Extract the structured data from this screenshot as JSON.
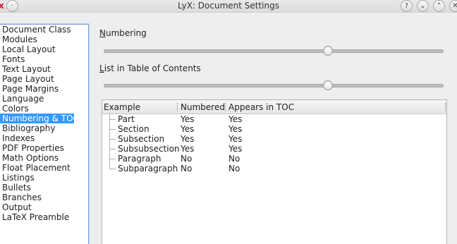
{
  "window": {
    "title": "LyX: Document Settings",
    "close_glyph": "x",
    "buttons": [
      "?",
      "⌄",
      "⌃",
      "✕"
    ]
  },
  "sidebar": {
    "items": [
      "Document Class",
      "Modules",
      "Local Layout",
      "Fonts",
      "Text Layout",
      "Page Layout",
      "Page Margins",
      "Language",
      "Colors",
      "Numbering & TOC",
      "Bibliography",
      "Indexes",
      "PDF Properties",
      "Math Options",
      "Float Placement",
      "Listings",
      "Bullets",
      "Branches",
      "Output",
      "LaTeX Preamble"
    ],
    "selected": "Numbering & TOC"
  },
  "numbering": {
    "label_first": "N",
    "label_rest": "umbering",
    "slider_level": 0.66
  },
  "toc": {
    "label_first": "L",
    "label_rest": "ist in Table of Contents",
    "slider_level": 0.66
  },
  "table": {
    "headers": {
      "example": "Example",
      "numbered": "Numbered",
      "toc": "Appears in TOC"
    },
    "rows": [
      {
        "example": "Part",
        "numbered": "Yes",
        "toc": "Yes"
      },
      {
        "example": "Section",
        "numbered": "Yes",
        "toc": "Yes"
      },
      {
        "example": "Subsection",
        "numbered": "Yes",
        "toc": "Yes"
      },
      {
        "example": "Subsubsection",
        "numbered": "Yes",
        "toc": "Yes"
      },
      {
        "example": "Paragraph",
        "numbered": "No",
        "toc": "No"
      },
      {
        "example": "Subparagraph",
        "numbered": "No",
        "toc": "No"
      }
    ]
  }
}
